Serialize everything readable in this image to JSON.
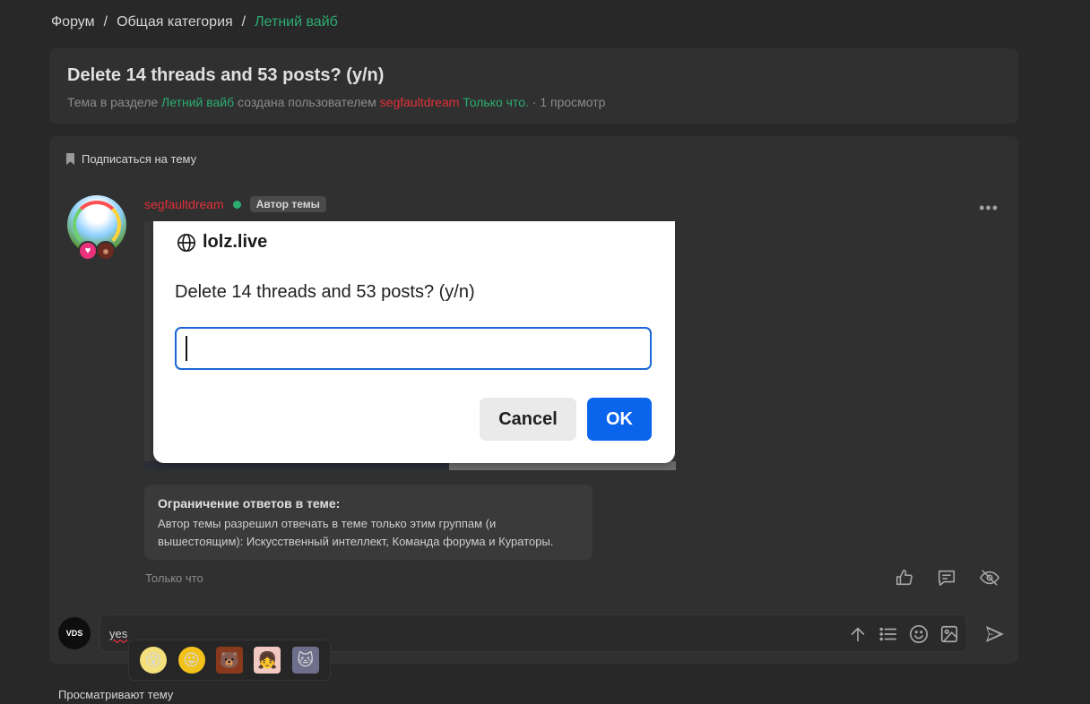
{
  "breadcrumb": {
    "forum": "Форум",
    "sep1": "/",
    "category": "Общая категория",
    "sep2": "/",
    "current": "Летний вайб"
  },
  "thread": {
    "title": "Delete 14 threads and 53 posts? (y/n)",
    "meta_prefix": "Тема в разделе",
    "meta_section": "Летний вайб",
    "meta_created_by": "создана пользователем",
    "meta_author": "segfaultdream",
    "meta_time": "Только что.",
    "meta_views": "· 1 просмотр"
  },
  "post": {
    "subscribe_label": "Подписаться на тему",
    "author": "segfaultdream",
    "author_badge": "Автор темы",
    "more_label": "•••",
    "time": "Только что"
  },
  "dialog": {
    "site": "lolz.live",
    "message": "Delete 14 threads and 53 posts? (y/n)",
    "input_value": "",
    "cancel_label": "Cancel",
    "ok_label": "OK"
  },
  "restriction": {
    "title": "Ограничение ответов в теме:",
    "text": "Автор темы разрешил отвечать в теме только этим группам (и вышестоящим): Искусственный интеллект, Команда форума и Кураторы."
  },
  "reply": {
    "avatar_text": "VDS",
    "text": "yes"
  },
  "emojis": [
    "😵",
    "😜",
    "🐻",
    "👧",
    "🐱"
  ],
  "viewers_label": "Просматривают тему",
  "colors": {
    "background": "#282828",
    "panel": "#303030",
    "accent_green": "#2bad72",
    "accent_red": "#e0303a",
    "dialog_ok": "#0a64ec"
  }
}
